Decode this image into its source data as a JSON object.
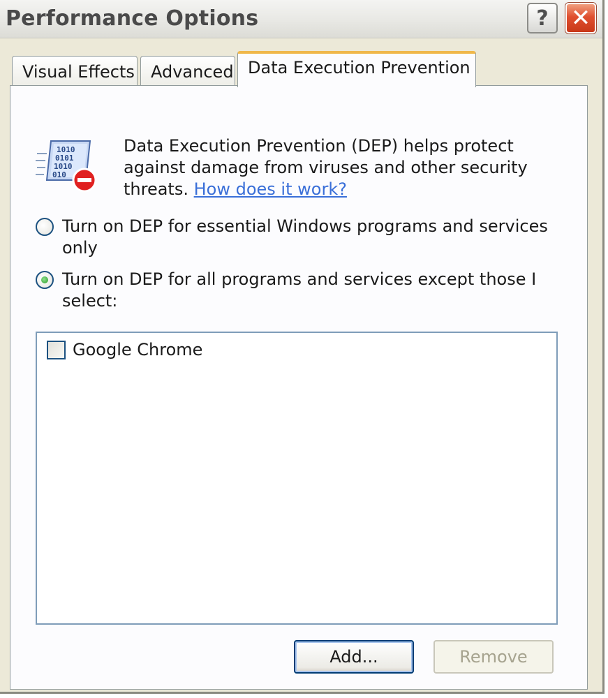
{
  "window": {
    "title": "Performance Options",
    "help_symbol": "?",
    "close_symbol": "✕"
  },
  "tabs": [
    {
      "label": "Visual Effects",
      "active": false
    },
    {
      "label": "Advanced",
      "active": false
    },
    {
      "label": "Data Execution Prevention",
      "active": true
    }
  ],
  "dep": {
    "icon": "dep-shield-icon",
    "description": "Data Execution Prevention (DEP) helps protect against damage from viruses and other security threats.",
    "link_text": "How does it work?",
    "options": [
      {
        "label": "Turn on DEP for essential Windows programs and services only",
        "selected": false
      },
      {
        "label": "Turn on DEP for all programs and services except those I select:",
        "selected": true
      }
    ],
    "programs": [
      {
        "label": "Google Chrome",
        "checked": false
      }
    ],
    "add_button": "Add...",
    "remove_button": "Remove"
  },
  "colors": {
    "link": "#3a6fd8",
    "active_tab_accent": "#f0b84a",
    "close_button": "#e05030",
    "radio_dot": "#2a9a2a"
  }
}
